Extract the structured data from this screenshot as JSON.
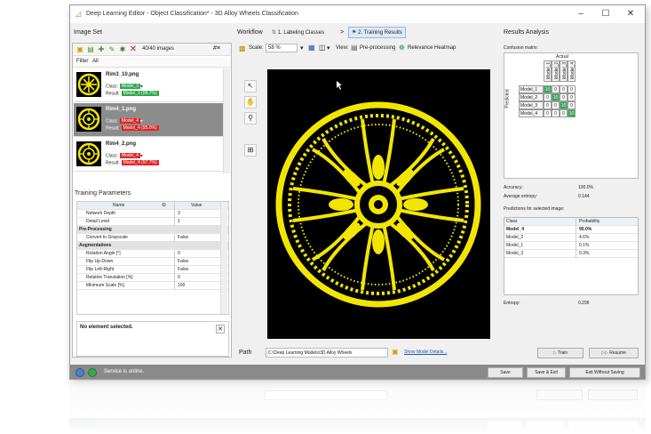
{
  "window": {
    "title": "Deep Learning Editor - Object Classification* - 3D Alloy Wheels Classification",
    "minimize": "–",
    "maximize": "☐",
    "close": "✕"
  },
  "left_panel": {
    "header": "Image Set",
    "image_count": "40/40 images",
    "filter_label": "Filter",
    "filter_value": "All",
    "class_label": "Class:",
    "result_label": "Result:",
    "images": [
      {
        "name": "Rim3_10.png",
        "class": "Model_3",
        "result": "Model_3 (98.7%)",
        "class_color": "#2ea84a",
        "result_color": "#2ea84a"
      },
      {
        "name": "Rim4_1.png",
        "class": "Model_4",
        "result": "Model_4 (95.0%)",
        "class_color": "#e02424",
        "result_color": "#e02424"
      },
      {
        "name": "Rim4_2.png",
        "class": "Model_4",
        "result": "Model_4 (97.7%)",
        "class_color": "#e02424",
        "result_color": "#e02424"
      }
    ]
  },
  "training_params": {
    "header": "Training Parameters",
    "col_name": "Name",
    "col_value": "Value",
    "rows": [
      {
        "name": "Network Depth",
        "value": "3"
      },
      {
        "name": "Detail Level",
        "value": "1"
      }
    ],
    "section_pre": "Pre-Processing",
    "pre_rows": [
      {
        "name": "Convert to Grayscale",
        "value": "False"
      }
    ],
    "section_aug": "Augmentations",
    "aug_rows": [
      {
        "name": "Rotation Angle [°]",
        "value": "0"
      },
      {
        "name": "Flip Up-Down",
        "value": "False"
      },
      {
        "name": "Flip Left-Right",
        "value": "False"
      },
      {
        "name": "Relative Translation [%]",
        "value": "0"
      },
      {
        "name": "Minimum Scale [%]",
        "value": "100"
      }
    ],
    "no_selection": "No element selected."
  },
  "workflow": {
    "label": "Workflow",
    "step1": "1. Labeling Classes",
    "separator": ">",
    "step2": "2. Training Results",
    "scale_label": "Scale:",
    "scale_value": "58 %",
    "view_label": "View:",
    "view_pre": "Pre-processing",
    "view_heatmap": "Relevance Heatmap"
  },
  "path": {
    "label": "Path",
    "value": "C:\\Deep Learning Models\\3D Alloy Wheels",
    "link": "Show Model Details..."
  },
  "results": {
    "header": "Results Analysis",
    "confusion_label": "Confusion matrix:",
    "actual_label": "Actual",
    "predicted_label": "Predicted",
    "classes": [
      "Model_1",
      "Model_2",
      "Model_3",
      "Model_4"
    ],
    "matrix": [
      [
        "10",
        "0",
        "0",
        "0"
      ],
      [
        "0",
        "10",
        "0",
        "0"
      ],
      [
        "0",
        "0",
        "10",
        "0"
      ],
      [
        "0",
        "0",
        "0",
        "10"
      ]
    ],
    "accuracy_label": "Accuracy:",
    "accuracy_value": "100.0%",
    "entropy_avg_label": "Average entropy:",
    "entropy_avg_value": "0.144",
    "pred_label": "Predictions for selected image:",
    "pred_col_class": "Class",
    "pred_col_prob": "Probability",
    "predictions": [
      {
        "class": "Model_4",
        "prob": "95.0%"
      },
      {
        "class": "Model_2",
        "prob": "4.6%"
      },
      {
        "class": "Model_1",
        "prob": "0.1%"
      },
      {
        "class": "Model_3",
        "prob": "0.3%"
      }
    ],
    "entropy_label": "Entropy:",
    "entropy_value": "0.296",
    "train_button": "Train",
    "resume_button": "Resume"
  },
  "status": {
    "text": "Service is online.",
    "save": "Save",
    "save_exit": "Save & Exit",
    "exit_nosave": "Exit Without Saving"
  },
  "colors": {
    "accent_green": "#2ea84a",
    "accent_red": "#e02424",
    "wheel_yellow": "#f2e600"
  }
}
